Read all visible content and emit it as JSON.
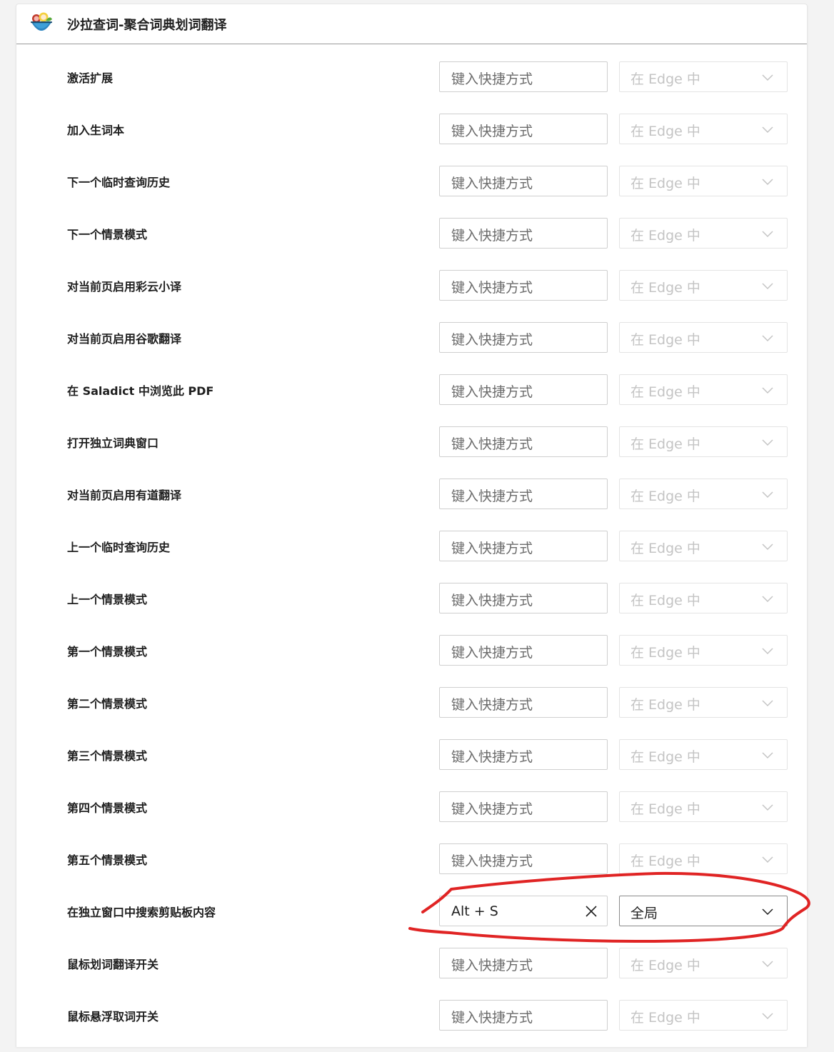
{
  "header": {
    "title": "沙拉查词-聚合词典划词翻译",
    "icon": "saladict-logo-icon"
  },
  "colors": {
    "annotation": "#e02424",
    "text": "#1f1f1f",
    "placeholder": "#6b6b6b",
    "disabled": "#c4c4c4"
  },
  "rows": [
    {
      "label": "激活扩展",
      "shortcut": "",
      "placeholder": "键入快捷方式",
      "scope": "在 Edge 中",
      "enabled": false
    },
    {
      "label": "加入生词本",
      "shortcut": "",
      "placeholder": "键入快捷方式",
      "scope": "在 Edge 中",
      "enabled": false
    },
    {
      "label": "下一个临时查询历史",
      "shortcut": "",
      "placeholder": "键入快捷方式",
      "scope": "在 Edge 中",
      "enabled": false
    },
    {
      "label": "下一个情景模式",
      "shortcut": "",
      "placeholder": "键入快捷方式",
      "scope": "在 Edge 中",
      "enabled": false
    },
    {
      "label": "对当前页启用彩云小译",
      "shortcut": "",
      "placeholder": "键入快捷方式",
      "scope": "在 Edge 中",
      "enabled": false
    },
    {
      "label": "对当前页启用谷歌翻译",
      "shortcut": "",
      "placeholder": "键入快捷方式",
      "scope": "在 Edge 中",
      "enabled": false
    },
    {
      "label": "在 Saladict 中浏览此 PDF",
      "shortcut": "",
      "placeholder": "键入快捷方式",
      "scope": "在 Edge 中",
      "enabled": false
    },
    {
      "label": "打开独立词典窗口",
      "shortcut": "",
      "placeholder": "键入快捷方式",
      "scope": "在 Edge 中",
      "enabled": false
    },
    {
      "label": "对当前页启用有道翻译",
      "shortcut": "",
      "placeholder": "键入快捷方式",
      "scope": "在 Edge 中",
      "enabled": false
    },
    {
      "label": "上一个临时查询历史",
      "shortcut": "",
      "placeholder": "键入快捷方式",
      "scope": "在 Edge 中",
      "enabled": false
    },
    {
      "label": "上一个情景模式",
      "shortcut": "",
      "placeholder": "键入快捷方式",
      "scope": "在 Edge 中",
      "enabled": false
    },
    {
      "label": "第一个情景模式",
      "shortcut": "",
      "placeholder": "键入快捷方式",
      "scope": "在 Edge 中",
      "enabled": false
    },
    {
      "label": "第二个情景模式",
      "shortcut": "",
      "placeholder": "键入快捷方式",
      "scope": "在 Edge 中",
      "enabled": false
    },
    {
      "label": "第三个情景模式",
      "shortcut": "",
      "placeholder": "键入快捷方式",
      "scope": "在 Edge 中",
      "enabled": false
    },
    {
      "label": "第四个情景模式",
      "shortcut": "",
      "placeholder": "键入快捷方式",
      "scope": "在 Edge 中",
      "enabled": false
    },
    {
      "label": "第五个情景模式",
      "shortcut": "",
      "placeholder": "键入快捷方式",
      "scope": "在 Edge 中",
      "enabled": false
    },
    {
      "label": "在独立窗口中搜索剪贴板内容",
      "shortcut": "Alt + S",
      "placeholder": "键入快捷方式",
      "scope": "全局",
      "enabled": true,
      "annotated": true
    },
    {
      "label": "鼠标划词翻译开关",
      "shortcut": "",
      "placeholder": "键入快捷方式",
      "scope": "在 Edge 中",
      "enabled": false
    },
    {
      "label": "鼠标悬浮取词开关",
      "shortcut": "",
      "placeholder": "键入快捷方式",
      "scope": "在 Edge 中",
      "enabled": false
    }
  ]
}
